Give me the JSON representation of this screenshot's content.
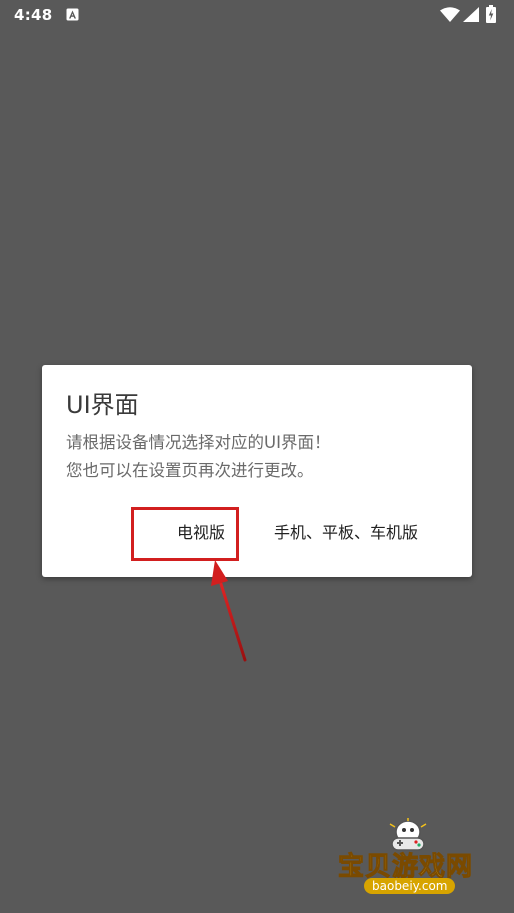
{
  "status_bar": {
    "time": "4:48"
  },
  "dialog": {
    "title": "UI界面",
    "message_line1": "请根据设备情况选择对应的UI界面！",
    "message_line2": "您也可以在设置页再次进行更改。",
    "buttons": {
      "tv": "电视版",
      "mobile": "手机、平板、车机版"
    }
  },
  "annotation": {
    "color": "#d21f1f"
  },
  "watermark": {
    "title": "宝贝游戏网",
    "url": "baobeiy.com"
  },
  "colors": {
    "scrim": "#595959",
    "dialog_bg": "#ffffff",
    "highlight": "#d21f1f",
    "watermark_gold": "#f4c21a"
  }
}
